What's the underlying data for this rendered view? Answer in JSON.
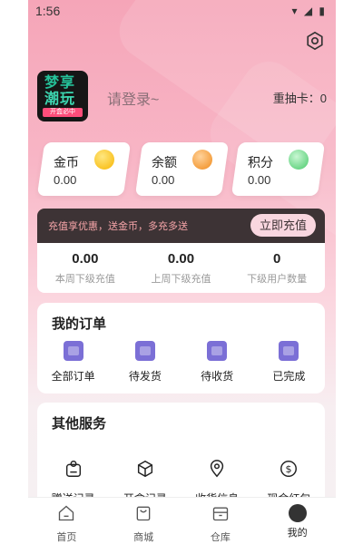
{
  "status": {
    "time": "1:56",
    "icons": "▾ ◢ ▮"
  },
  "logo": {
    "line1": "梦享",
    "line2": "潮玩",
    "tag": "开盒必中"
  },
  "profile": {
    "login": "请登录~",
    "redraw_label": "重抽卡：",
    "redraw_count": "0"
  },
  "wallet": [
    {
      "label": "金币",
      "value": "0.00",
      "icon": "gold-coin-icon"
    },
    {
      "label": "余额",
      "value": "0.00",
      "icon": "dollar-coin-icon"
    },
    {
      "label": "积分",
      "value": "0.00",
      "icon": "star-points-icon"
    }
  ],
  "recharge": {
    "text": "充值享优惠，送金币，多充多送",
    "button": "立即充值"
  },
  "stats": [
    {
      "value": "0.00",
      "label": "本周下级充值"
    },
    {
      "value": "0.00",
      "label": "上周下级充值"
    },
    {
      "value": "0",
      "label": "下级用户数量"
    }
  ],
  "orders": {
    "title": "我的订单",
    "items": [
      {
        "label": "全部订单"
      },
      {
        "label": "待发货"
      },
      {
        "label": "待收货"
      },
      {
        "label": "已完成"
      }
    ]
  },
  "services": {
    "title": "其他服务",
    "items": [
      {
        "label": "赠送记录"
      },
      {
        "label": "开盒记录"
      },
      {
        "label": "收货信息"
      },
      {
        "label": "现金红包"
      }
    ]
  },
  "tabs": [
    {
      "label": "首页"
    },
    {
      "label": "商城"
    },
    {
      "label": "仓库"
    },
    {
      "label": "我的"
    }
  ],
  "colors": {
    "accent": "#f5a5b8",
    "dark_banner": "#3d3335",
    "order_icon": "#7b6fd6"
  }
}
